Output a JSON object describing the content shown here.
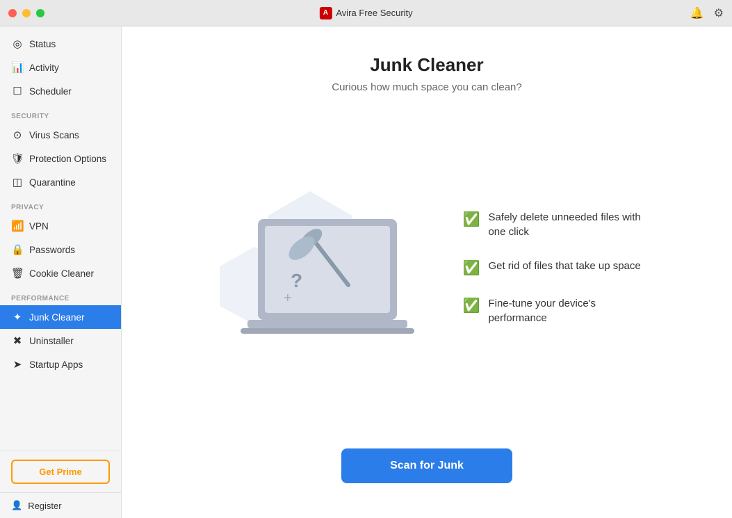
{
  "titleBar": {
    "appName": "Avira Free Security",
    "logoText": "A",
    "notificationIconLabel": "notifications",
    "settingsIconLabel": "settings"
  },
  "sidebar": {
    "sections": [
      {
        "items": [
          {
            "id": "status",
            "label": "Status",
            "icon": "○"
          },
          {
            "id": "activity",
            "label": "Activity",
            "icon": "📊"
          },
          {
            "id": "scheduler",
            "label": "Scheduler",
            "icon": "🗓"
          }
        ]
      },
      {
        "label": "Security",
        "items": [
          {
            "id": "virus-scans",
            "label": "Virus Scans",
            "icon": "⚙"
          },
          {
            "id": "protection-options",
            "label": "Protection Options",
            "icon": "🛡"
          },
          {
            "id": "quarantine",
            "label": "Quarantine",
            "icon": "📦"
          }
        ]
      },
      {
        "label": "Privacy",
        "items": [
          {
            "id": "vpn",
            "label": "VPN",
            "icon": "📶"
          },
          {
            "id": "passwords",
            "label": "Passwords",
            "icon": "🔒"
          },
          {
            "id": "cookie-cleaner",
            "label": "Cookie Cleaner",
            "icon": "🗑"
          }
        ]
      },
      {
        "label": "Performance",
        "items": [
          {
            "id": "junk-cleaner",
            "label": "Junk Cleaner",
            "icon": "🧹",
            "active": true
          },
          {
            "id": "uninstaller",
            "label": "Uninstaller",
            "icon": "✖"
          },
          {
            "id": "startup-apps",
            "label": "Startup Apps",
            "icon": "🚀"
          }
        ]
      }
    ],
    "getPrimeLabel": "Get Prime",
    "registerLabel": "Register"
  },
  "content": {
    "title": "Junk Cleaner",
    "subtitle": "Curious how much space you can clean?",
    "features": [
      {
        "text": "Safely delete unneeded files with one click"
      },
      {
        "text": "Get rid of files that take up space"
      },
      {
        "text": "Fine-tune your device's performance"
      }
    ],
    "scanButton": "Scan for Junk"
  }
}
